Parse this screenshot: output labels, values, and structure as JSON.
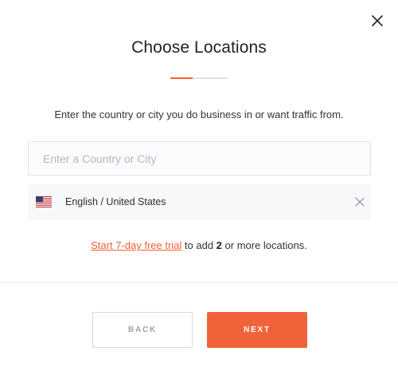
{
  "dialog": {
    "title": "Choose Locations",
    "progress": 0.38,
    "subtitle": "Enter the country or city you do business in or want traffic from."
  },
  "search": {
    "placeholder": "Enter a Country or City",
    "value": ""
  },
  "selected_location": {
    "flag_icon": "us-flag-icon",
    "label": "English / United States"
  },
  "trial": {
    "link_text": "Start 7-day free trial",
    "text_before_count": " to add ",
    "count": "2",
    "text_after_count": " or more locations."
  },
  "buttons": {
    "back_label": "BACK",
    "next_label": "NEXT"
  },
  "colors": {
    "accent": "#f06136",
    "progress_track": "#e3e3e3"
  }
}
